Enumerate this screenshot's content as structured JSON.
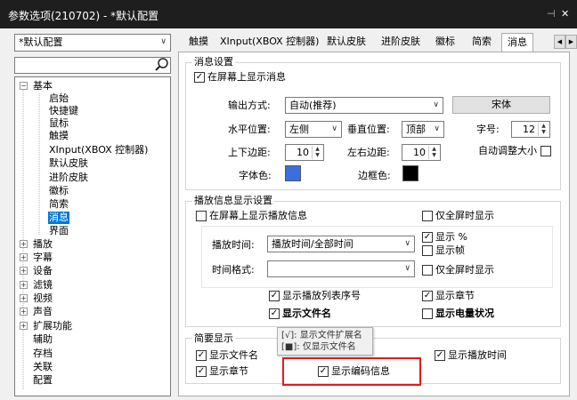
{
  "window": {
    "title": "参数选项(210702) - *默认配置",
    "pin_icon": "pin-icon",
    "close_icon": "close-icon"
  },
  "profile": {
    "value": "*默认配置"
  },
  "search": {
    "value": "",
    "icon": "search-icon"
  },
  "tree": {
    "items": [
      {
        "label": "基本",
        "expander": "⊟"
      },
      {
        "label": "启始"
      },
      {
        "label": "快捷键"
      },
      {
        "label": "鼠标"
      },
      {
        "label": "触摸"
      },
      {
        "label": "XInput(XBOX 控制器)"
      },
      {
        "label": "默认皮肤"
      },
      {
        "label": "进阶皮肤"
      },
      {
        "label": "徽标"
      },
      {
        "label": "简索"
      },
      {
        "label": "消息"
      },
      {
        "label": "界面"
      },
      {
        "label": "播放",
        "expander": "⊞"
      },
      {
        "label": "字幕",
        "expander": "⊞"
      },
      {
        "label": "设备",
        "expander": "⊞"
      },
      {
        "label": "滤镜",
        "expander": "⊞"
      },
      {
        "label": "视频",
        "expander": "⊞"
      },
      {
        "label": "声音",
        "expander": "⊞"
      },
      {
        "label": "扩展功能",
        "expander": "⊞"
      },
      {
        "label": "辅助"
      },
      {
        "label": "存档"
      },
      {
        "label": "关联"
      },
      {
        "label": "配置"
      }
    ]
  },
  "tabs": [
    "触摸",
    "XInput(XBOX 控制器)",
    "默认皮肤",
    "进阶皮肤",
    "徽标",
    "简索",
    "消息"
  ],
  "tab_scroll": {
    "left": "◀",
    "right": "▶"
  },
  "msg_settings": {
    "title": "消息设置",
    "show_on_screen": {
      "label": "在屏幕上显示消息",
      "checked": "✓"
    },
    "output_label": "输出方式:",
    "output_value": "自动(推荐)",
    "font_button": "宋体",
    "hpos_label": "水平位置:",
    "hpos_value": "左侧",
    "vpos_label": "垂直位置:",
    "vpos_value": "顶部",
    "fontsize_label": "字号:",
    "fontsize_value": "12",
    "tb_margin_label": "上下边距:",
    "tb_margin_value": "10",
    "lr_margin_label": "左右边距:",
    "lr_margin_value": "10",
    "autosize_label": "自动调整大小",
    "font_color_label": "字体色:",
    "font_color": "#3a6fe0",
    "border_color_label": "边框色:",
    "border_color": "#000000"
  },
  "play_info": {
    "title": "播放信息显示设置",
    "show_on_screen": {
      "label": "在屏幕上显示播放信息"
    },
    "fullscreen_only": {
      "label": "仅全屏时显示"
    },
    "time_label": "播放时间:",
    "time_value": "播放时间/全部时间",
    "show_pct": {
      "label": "显示 %",
      "checked": "✓"
    },
    "show_frame": {
      "label": "显示帧"
    },
    "time_format_label": "时间格式:",
    "time_format_value": "",
    "fullscreen_only2": {
      "label": "仅全屏时显示"
    },
    "show_playlist_no": {
      "label": "显示播放列表序号",
      "checked": "✓"
    },
    "show_chapter": {
      "label": "显示章节",
      "checked": "✓"
    },
    "show_filename": {
      "label": "显示文件名",
      "checked": "✓"
    },
    "show_battery": {
      "label": "显示电量状况"
    }
  },
  "summary": {
    "title": "简要显示",
    "show_filename": {
      "label": "显示文件名",
      "checked": "✓"
    },
    "show_play_time": {
      "label": "显示播放时间",
      "checked": "✓"
    },
    "show_chapter": {
      "label": "显示章节",
      "checked": "✓"
    },
    "show_codec": {
      "label": "显示编码信息",
      "checked": "✓"
    }
  },
  "tooltip": {
    "line1": "[√]: 显示文件扩展名",
    "line2": "[■]: 仅显示文件名"
  },
  "colors": {
    "accent": "#0078d7",
    "highlight": "#e21b1b",
    "titlebar": "#1e1e1e"
  }
}
